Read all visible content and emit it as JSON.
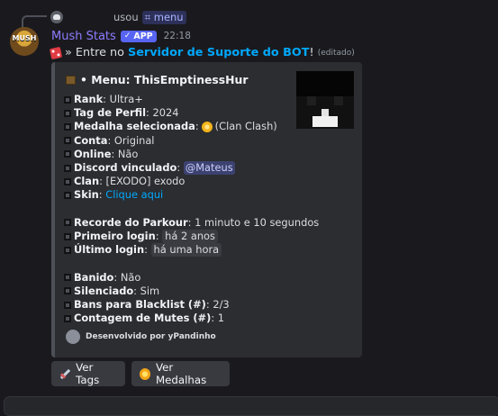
{
  "reply": {
    "used_label": "usou",
    "command": "⌗ menu"
  },
  "message": {
    "avatar_text": "MUSH",
    "username": "Mush Stats",
    "badge": "APP",
    "badge_icon": "check-icon",
    "timestamp": "22:18",
    "text_prefix": "» Entre no",
    "server_link": "Servidor de Suporte do BOT",
    "text_suffix": "!",
    "edited": "(editado)"
  },
  "embed": {
    "title": "• Menu: ThisEmptinessHur",
    "fields": [
      {
        "label": "Rank",
        "value": ": Ultra+"
      },
      {
        "label": "Tag de Perfil",
        "value": ": 2024"
      },
      {
        "label": "Medalha selecionada",
        "value": "(Clan Clash)"
      },
      {
        "label": "Conta",
        "value": ": Original"
      },
      {
        "label": "Online",
        "value": ": Não"
      },
      {
        "label": "Discord vinculado",
        "value": "@Mateus"
      },
      {
        "label": "Clan",
        "value": ": [EXODO] exodo"
      },
      {
        "label": "Skin",
        "value": "Clique aqui"
      },
      {
        "label": "Recorde do Parkour",
        "value": ": 1 minuto e 10 segundos"
      },
      {
        "label": "Primeiro login",
        "value": "há 2 anos"
      },
      {
        "label": "Último login",
        "value": "há uma hora"
      },
      {
        "label": "Banido",
        "value": ": Não"
      },
      {
        "label": "Silenciado",
        "value": ": Sim"
      },
      {
        "label": "Bans para Blacklist (#)",
        "value": ": 2/3"
      },
      {
        "label": "Contagem de Mutes (#)",
        "value": ": 1"
      }
    ],
    "footer": "Desenvolvido por yPandinho"
  },
  "buttons": {
    "tags": "Ver Tags",
    "medals": "Ver Medalhas"
  },
  "colors": {
    "background": "#1a1a1e",
    "embed": "#2b2d31",
    "accent": "#5865f2",
    "link": "#00a8fc"
  }
}
